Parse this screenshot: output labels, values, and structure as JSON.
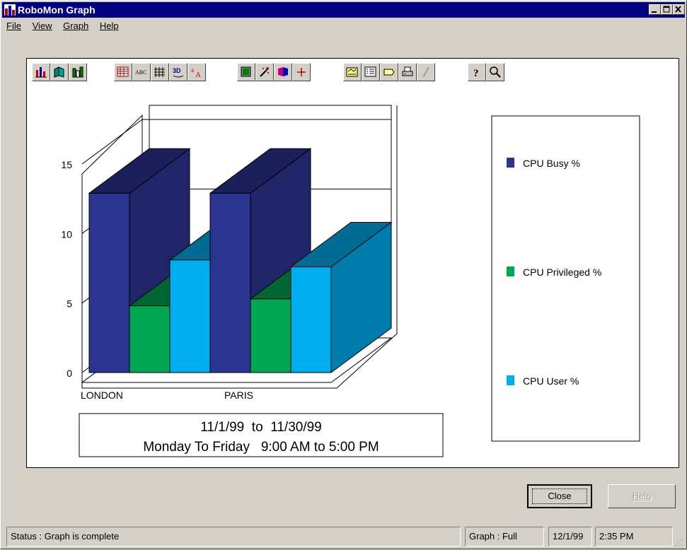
{
  "window": {
    "title": "RoboMon Graph"
  },
  "menu": [
    "File",
    "View",
    "Graph",
    "Help"
  ],
  "toolbar_icons": [
    "bar-chart-icon",
    "3d-bar-icon",
    "stacked-bar-icon",
    "data-grid-icon",
    "text-abc-icon",
    "gridlines-icon",
    "3d-toggle-icon",
    "font-icon",
    "color-fill-icon",
    "magic-wand-icon",
    "palette-icon",
    "crosshair-icon",
    "chart-title-icon",
    "legend-icon",
    "label-icon",
    "print-icon",
    "pen-icon",
    "help-icon",
    "zoom-icon"
  ],
  "chart_data": {
    "type": "bar",
    "categories": [
      "LONDON",
      "PARIS"
    ],
    "series": [
      {
        "name": "CPU Busy %",
        "values": [
          12.9,
          12.9
        ],
        "color": "#2b3491"
      },
      {
        "name": "CPU Privileged %",
        "values": [
          4.8,
          5.3
        ],
        "color": "#00a651"
      },
      {
        "name": "CPU User %",
        "values": [
          8.1,
          7.6
        ],
        "color": "#00aeef"
      }
    ],
    "ylim": [
      0,
      15
    ],
    "yticks": [
      "0",
      "5",
      "10",
      "15"
    ],
    "grid": true,
    "three_d": true,
    "legend_position": "right"
  },
  "caption": {
    "line1": "11/1/99  to  11/30/99",
    "line2": "Monday To Friday   9:00 AM to 5:00 PM"
  },
  "buttons": {
    "close": "Close",
    "help": "Help"
  },
  "status": {
    "message": "Status : Graph is complete",
    "mode": "Graph : Full",
    "date": "12/1/99",
    "time": "2:35 PM"
  }
}
